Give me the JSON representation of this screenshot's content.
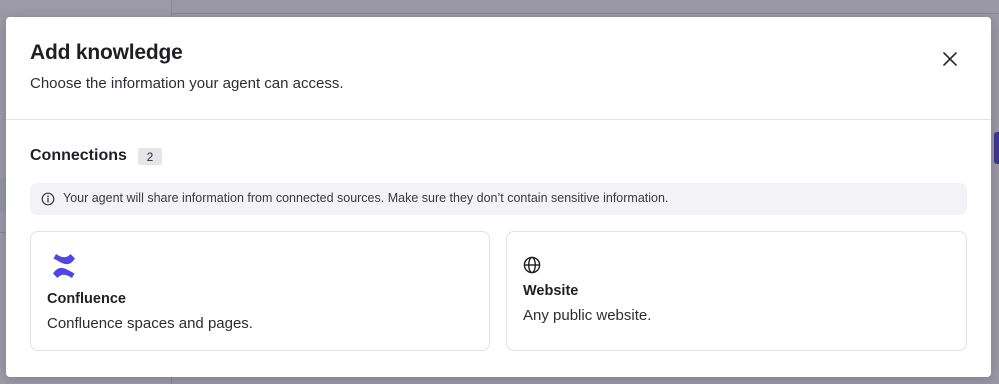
{
  "modal": {
    "title": "Add knowledge",
    "subtitle": "Choose the information your agent can access.",
    "close_icon": "close-icon"
  },
  "connections": {
    "heading": "Connections",
    "count": "2",
    "notice_icon": "info-icon",
    "notice": "Your agent will share information from connected sources. Make sure they don’t contain sensitive information.",
    "items": [
      {
        "name": "Confluence",
        "description": "Confluence spaces and pages.",
        "icon": "confluence-logo-icon",
        "icon_color": "#4f46e5"
      },
      {
        "name": "Website",
        "description": "Any public website.",
        "icon": "globe-icon"
      }
    ]
  },
  "colors": {
    "overlay": "#9a98a4",
    "accent": "#3f3990",
    "badge_bg": "#e6e6ea",
    "notice_bg": "#f3f3f5"
  }
}
